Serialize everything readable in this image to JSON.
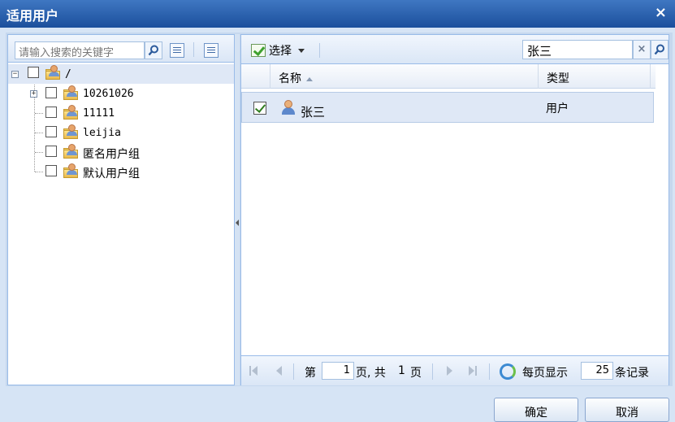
{
  "window": {
    "title": "适用用户",
    "close_label": "×"
  },
  "left": {
    "search_placeholder": "请输入搜索的关键字",
    "tree": [
      {
        "label": "/",
        "expander": "−"
      },
      {
        "label": "10261026",
        "expander": "+"
      },
      {
        "label": "11111"
      },
      {
        "label": "leijia"
      },
      {
        "label": "匿名用户组"
      },
      {
        "label": "默认用户组"
      }
    ]
  },
  "right": {
    "select_label": "选择",
    "search_value": "张三",
    "clear_label": "×",
    "columns": {
      "name": "名称",
      "type": "类型"
    },
    "rows": [
      {
        "name": "张三",
        "type": "用户",
        "checked": true
      }
    ],
    "pager": {
      "page_prefix": "第",
      "page_value": "1",
      "page_mid": "页, 共",
      "total_pages": "1",
      "page_suffix": "页",
      "per_page_label": "每页显示",
      "per_page_value": "25",
      "records_label": "条记录"
    }
  },
  "footer": {
    "ok_label": "确定",
    "cancel_label": "取消"
  },
  "colors": {
    "title_bar": "#2a5ea9",
    "accent": "#99bbe8",
    "selection": "#dfe8f6"
  }
}
